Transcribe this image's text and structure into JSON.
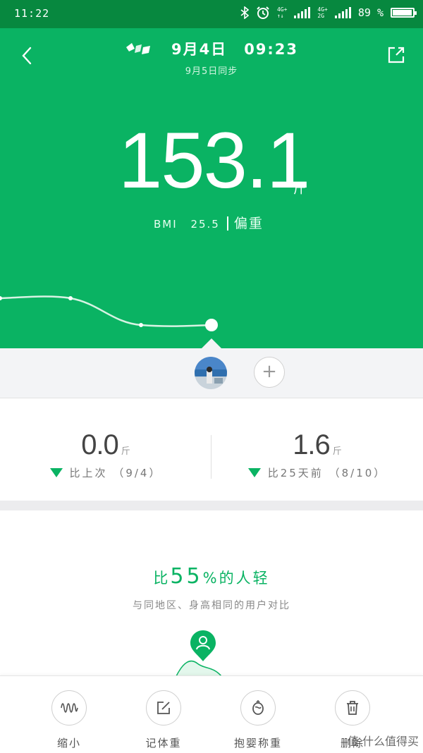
{
  "status_bar": {
    "time": "11:22",
    "network1_top": "4G+",
    "network1_bottom": "↑↓",
    "network2_top": "4G+",
    "network2_bottom": "2G",
    "battery_text": "89 %",
    "battery_level": 0.89
  },
  "header": {
    "date": "9月4日",
    "time": "09:23",
    "sync_text": "9月5日同步"
  },
  "measurement": {
    "weight": "153.1",
    "unit": "斤",
    "bmi_label": "BMI",
    "bmi_value": "25.5",
    "bmi_status": "偏重"
  },
  "compare": {
    "left": {
      "value": "0.0",
      "unit": "斤",
      "label": "比上次",
      "date": "（9/4）"
    },
    "right": {
      "value": "1.6",
      "unit": "斤",
      "label": "比25天前",
      "date": "（8/10）"
    }
  },
  "percentile": {
    "prefix": "比",
    "value": "55",
    "suffix": "%的人轻",
    "subtitle": "与同地区、身高相同的用户对比"
  },
  "toolbar": {
    "items": [
      {
        "label": "缩小",
        "icon": "wave-icon"
      },
      {
        "label": "记体重",
        "icon": "edit-icon"
      },
      {
        "label": "抱婴称重",
        "icon": "baby-icon"
      },
      {
        "label": "删除",
        "icon": "trash-icon"
      }
    ]
  },
  "watermark": "值 什么值得买",
  "colors": {
    "brand_green": "#0ab363",
    "status_bar": "#07883f",
    "trend_line": "#d7f3e3"
  }
}
